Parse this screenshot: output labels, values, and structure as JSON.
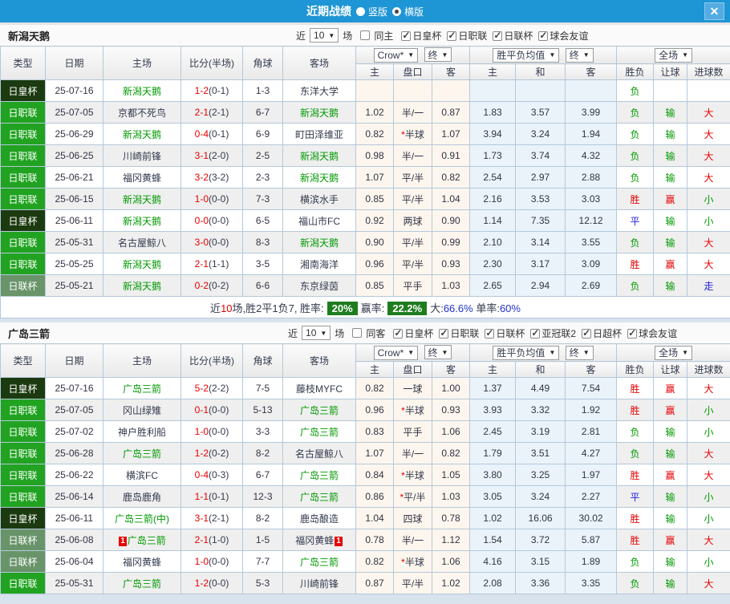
{
  "titlebar": {
    "title": "近期战绩",
    "radio_vertical": "竖版",
    "radio_horizontal": "横版",
    "close_icon": "✕"
  },
  "table_header": {
    "type": "类型",
    "date": "日期",
    "home": "主场",
    "score": "比分(半场)",
    "corner": "角球",
    "away": "客场",
    "crow": "Crow*",
    "final": "终",
    "mean": "胜平负均值",
    "final2": "终",
    "scope": "全场",
    "odds_home": "主",
    "odds_line": "盘口",
    "odds_away": "客",
    "mean_home": "主",
    "mean_draw": "和",
    "mean_away": "客",
    "wdl": "胜负",
    "let_ball": "让球",
    "goals": "进球数"
  },
  "colors": {
    "titlebar_blue": "#1e95d5",
    "league_green": "#21a321",
    "cup_dark_green": "#1c3a10",
    "league_cup_green": "#699469",
    "badge_green": "#1f7d1f",
    "win_red": "#e60000",
    "loss_green": "#009900",
    "draw_blue": "#2323dd"
  },
  "sections": [
    {
      "team": "新潟天鹅",
      "filter": {
        "recent": "近",
        "count": "10",
        "matches": "场",
        "same": "同主",
        "same_checked": false,
        "leagues": [
          {
            "label": "日皇杯",
            "checked": true
          },
          {
            "label": "日职联",
            "checked": true
          },
          {
            "label": "日联杯",
            "checked": true
          },
          {
            "label": "球会友谊",
            "checked": true
          }
        ]
      },
      "rows": [
        {
          "type": "日皇杯",
          "date": "25-07-16",
          "home": "新潟天鹅",
          "hg": true,
          "hc": "",
          "score": "1-2",
          "half": "(0-1)",
          "corner": "1-3",
          "away": "东洋大学",
          "ag": false,
          "ac": "",
          "oh": "",
          "ol": "",
          "oa": "",
          "mh": "",
          "md": "",
          "ma": "",
          "wdl": "负",
          "let": "",
          "goal": ""
        },
        {
          "type": "日职联",
          "date": "25-07-05",
          "home": "京都不死鸟",
          "hg": false,
          "hc": "",
          "score": "2-1",
          "half": "(2-1)",
          "corner": "6-7",
          "away": "新潟天鹅",
          "ag": true,
          "ac": "",
          "oh": "1.02",
          "ol": "半/一",
          "oa": "0.87",
          "mh": "1.83",
          "md": "3.57",
          "ma": "3.99",
          "wdl": "负",
          "let": "输",
          "goal": "大"
        },
        {
          "type": "日职联",
          "date": "25-06-29",
          "home": "新潟天鹅",
          "hg": true,
          "hc": "",
          "score": "0-4",
          "half": "(0-1)",
          "corner": "6-9",
          "away": "町田泽维亚",
          "ag": false,
          "ac": "",
          "oh": "0.82",
          "ol": "*半球",
          "oa": "1.07",
          "mh": "3.94",
          "md": "3.24",
          "ma": "1.94",
          "wdl": "负",
          "let": "输",
          "goal": "大"
        },
        {
          "type": "日职联",
          "date": "25-06-25",
          "home": "川崎前锋",
          "hg": false,
          "hc": "",
          "score": "3-1",
          "half": "(2-0)",
          "corner": "2-5",
          "away": "新潟天鹅",
          "ag": true,
          "ac": "",
          "oh": "0.98",
          "ol": "半/一",
          "oa": "0.91",
          "mh": "1.73",
          "md": "3.74",
          "ma": "4.32",
          "wdl": "负",
          "let": "输",
          "goal": "大"
        },
        {
          "type": "日职联",
          "date": "25-06-21",
          "home": "福冈黄蜂",
          "hg": false,
          "hc": "",
          "score": "3-2",
          "half": "(3-2)",
          "corner": "2-3",
          "away": "新潟天鹅",
          "ag": true,
          "ac": "",
          "oh": "1.07",
          "ol": "平/半",
          "oa": "0.82",
          "mh": "2.54",
          "md": "2.97",
          "ma": "2.88",
          "wdl": "负",
          "let": "输",
          "goal": "大"
        },
        {
          "type": "日职联",
          "date": "25-06-15",
          "home": "新潟天鹅",
          "hg": true,
          "hc": "",
          "score": "1-0",
          "half": "(0-0)",
          "corner": "7-3",
          "away": "横滨水手",
          "ag": false,
          "ac": "",
          "oh": "0.85",
          "ol": "平/半",
          "oa": "1.04",
          "mh": "2.16",
          "md": "3.53",
          "ma": "3.03",
          "wdl": "胜",
          "let": "赢",
          "goal": "小"
        },
        {
          "type": "日皇杯",
          "date": "25-06-11",
          "home": "新潟天鹅",
          "hg": true,
          "hc": "",
          "score": "0-0",
          "half": "(0-0)",
          "corner": "6-5",
          "away": "福山市FC",
          "ag": false,
          "ac": "",
          "oh": "0.92",
          "ol": "两球",
          "oa": "0.90",
          "mh": "1.14",
          "md": "7.35",
          "ma": "12.12",
          "wdl": "平",
          "let": "输",
          "goal": "小"
        },
        {
          "type": "日职联",
          "date": "25-05-31",
          "home": "名古屋鲸八",
          "hg": false,
          "hc": "",
          "score": "3-0",
          "half": "(0-0)",
          "corner": "8-3",
          "away": "新潟天鹅",
          "ag": true,
          "ac": "",
          "oh": "0.90",
          "ol": "平/半",
          "oa": "0.99",
          "mh": "2.10",
          "md": "3.14",
          "ma": "3.55",
          "wdl": "负",
          "let": "输",
          "goal": "大"
        },
        {
          "type": "日职联",
          "date": "25-05-25",
          "home": "新潟天鹅",
          "hg": true,
          "hc": "",
          "score": "2-1",
          "half": "(1-1)",
          "corner": "3-5",
          "away": "湘南海洋",
          "ag": false,
          "ac": "",
          "oh": "0.96",
          "ol": "平/半",
          "oa": "0.93",
          "mh": "2.30",
          "md": "3.17",
          "ma": "3.09",
          "wdl": "胜",
          "let": "赢",
          "goal": "大"
        },
        {
          "type": "日联杯",
          "date": "25-05-21",
          "home": "新潟天鹅",
          "hg": true,
          "hc": "",
          "score": "0-2",
          "half": "(0-2)",
          "corner": "6-6",
          "away": "东京绿茵",
          "ag": false,
          "ac": "",
          "oh": "0.85",
          "ol": "平手",
          "oa": "1.03",
          "mh": "2.65",
          "md": "2.94",
          "ma": "2.69",
          "wdl": "负",
          "let": "输",
          "goal": "走"
        }
      ],
      "summary": {
        "pre": "近",
        "count": "10",
        "mid": "场,胜2平1负7, 胜率:",
        "win": "20%",
        "profit_label": "赢率:",
        "profit": "22.2%",
        "big_label": "大:",
        "big": "66.6%",
        "single_label": "单率:",
        "single": "60%"
      }
    },
    {
      "team": "广岛三箭",
      "filter": {
        "recent": "近",
        "count": "10",
        "matches": "场",
        "same": "同客",
        "same_checked": false,
        "leagues": [
          {
            "label": "日皇杯",
            "checked": true
          },
          {
            "label": "日职联",
            "checked": true
          },
          {
            "label": "日联杯",
            "checked": true
          },
          {
            "label": "亚冠联2",
            "checked": true
          },
          {
            "label": "日超杯",
            "checked": true
          },
          {
            "label": "球会友谊",
            "checked": true
          }
        ]
      },
      "rows": [
        {
          "type": "日皇杯",
          "date": "25-07-16",
          "home": "广岛三箭",
          "hg": true,
          "hc": "",
          "score": "5-2",
          "half": "(2-2)",
          "corner": "7-5",
          "away": "藤枝MYFC",
          "ag": false,
          "ac": "",
          "oh": "0.82",
          "ol": "一球",
          "oa": "1.00",
          "mh": "1.37",
          "md": "4.49",
          "ma": "7.54",
          "wdl": "胜",
          "let": "赢",
          "goal": "大"
        },
        {
          "type": "日职联",
          "date": "25-07-05",
          "home": "冈山绿雉",
          "hg": false,
          "hc": "",
          "score": "0-1",
          "half": "(0-0)",
          "corner": "5-13",
          "away": "广岛三箭",
          "ag": true,
          "ac": "",
          "oh": "0.96",
          "ol": "*半球",
          "oa": "0.93",
          "mh": "3.93",
          "md": "3.32",
          "ma": "1.92",
          "wdl": "胜",
          "let": "赢",
          "goal": "小"
        },
        {
          "type": "日职联",
          "date": "25-07-02",
          "home": "神户胜利船",
          "hg": false,
          "hc": "",
          "score": "1-0",
          "half": "(0-0)",
          "corner": "3-3",
          "away": "广岛三箭",
          "ag": true,
          "ac": "",
          "oh": "0.83",
          "ol": "平手",
          "oa": "1.06",
          "mh": "2.45",
          "md": "3.19",
          "ma": "2.81",
          "wdl": "负",
          "let": "输",
          "goal": "小"
        },
        {
          "type": "日职联",
          "date": "25-06-28",
          "home": "广岛三箭",
          "hg": true,
          "hc": "",
          "score": "1-2",
          "half": "(0-2)",
          "corner": "8-2",
          "away": "名古屋鲸八",
          "ag": false,
          "ac": "",
          "oh": "1.07",
          "ol": "半/一",
          "oa": "0.82",
          "mh": "1.79",
          "md": "3.51",
          "ma": "4.27",
          "wdl": "负",
          "let": "输",
          "goal": "大"
        },
        {
          "type": "日职联",
          "date": "25-06-22",
          "home": "横滨FC",
          "hg": false,
          "hc": "",
          "score": "0-4",
          "half": "(0-3)",
          "corner": "6-7",
          "away": "广岛三箭",
          "ag": true,
          "ac": "",
          "oh": "0.84",
          "ol": "*半球",
          "oa": "1.05",
          "mh": "3.80",
          "md": "3.25",
          "ma": "1.97",
          "wdl": "胜",
          "let": "赢",
          "goal": "大"
        },
        {
          "type": "日职联",
          "date": "25-06-14",
          "home": "鹿岛鹿角",
          "hg": false,
          "hc": "",
          "score": "1-1",
          "half": "(0-1)",
          "corner": "12-3",
          "away": "广岛三箭",
          "ag": true,
          "ac": "",
          "oh": "0.86",
          "ol": "*平/半",
          "oa": "1.03",
          "mh": "3.05",
          "md": "3.24",
          "ma": "2.27",
          "wdl": "平",
          "let": "输",
          "goal": "小"
        },
        {
          "type": "日皇杯",
          "date": "25-06-11",
          "home": "广岛三箭(中)",
          "hg": true,
          "hc": "",
          "score": "3-1",
          "half": "(2-1)",
          "corner": "8-2",
          "away": "鹿岛酿造",
          "ag": false,
          "ac": "",
          "oh": "1.04",
          "ol": "四球",
          "oa": "0.78",
          "mh": "1.02",
          "md": "16.06",
          "ma": "30.02",
          "wdl": "胜",
          "let": "输",
          "goal": "小"
        },
        {
          "type": "日联杯",
          "date": "25-06-08",
          "home": "广岛三箭",
          "hg": true,
          "hc": "1",
          "score": "2-1",
          "half": "(1-0)",
          "corner": "1-5",
          "away": "福冈黄蜂",
          "ag": false,
          "ac": "1",
          "oh": "0.78",
          "ol": "半/一",
          "oa": "1.12",
          "mh": "1.54",
          "md": "3.72",
          "ma": "5.87",
          "wdl": "胜",
          "let": "赢",
          "goal": "大"
        },
        {
          "type": "日联杯",
          "date": "25-06-04",
          "home": "福冈黄蜂",
          "hg": false,
          "hc": "",
          "score": "1-0",
          "half": "(0-0)",
          "corner": "7-7",
          "away": "广岛三箭",
          "ag": true,
          "ac": "",
          "oh": "0.82",
          "ol": "*半球",
          "oa": "1.06",
          "mh": "4.16",
          "md": "3.15",
          "ma": "1.89",
          "wdl": "负",
          "let": "输",
          "goal": "小"
        },
        {
          "type": "日职联",
          "date": "25-05-31",
          "home": "广岛三箭",
          "hg": true,
          "hc": "",
          "score": "1-2",
          "half": "(0-0)",
          "corner": "5-3",
          "away": "川崎前锋",
          "ag": false,
          "ac": "",
          "oh": "0.87",
          "ol": "平/半",
          "oa": "1.02",
          "mh": "2.08",
          "md": "3.36",
          "ma": "3.35",
          "wdl": "负",
          "let": "输",
          "goal": "大"
        }
      ]
    }
  ]
}
